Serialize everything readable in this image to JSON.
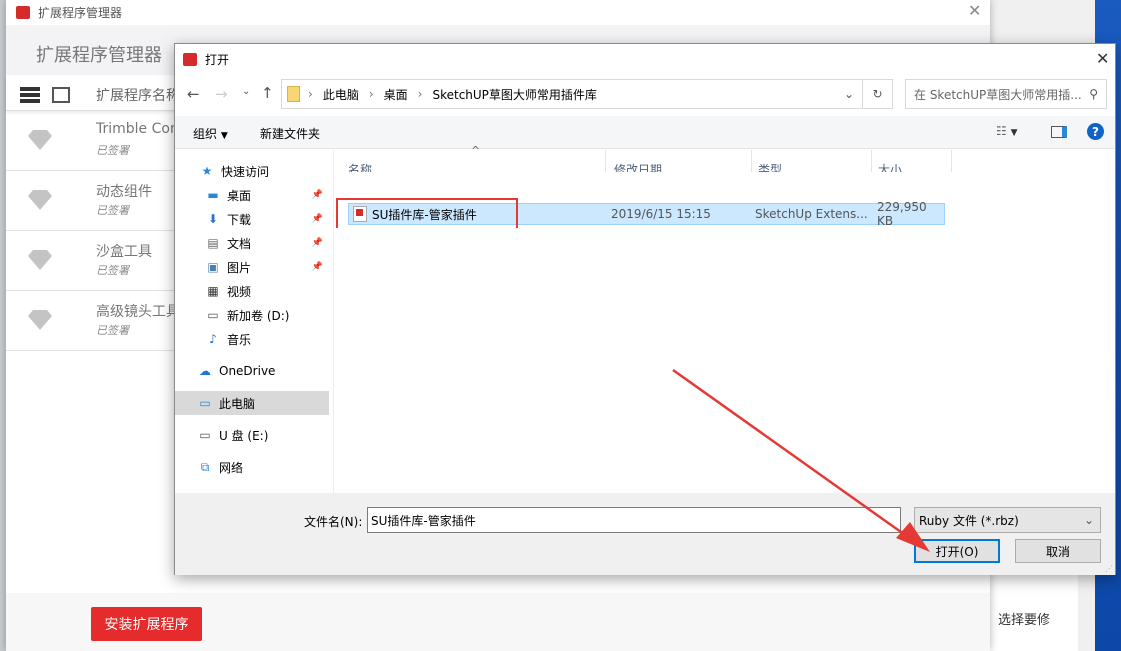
{
  "background": {
    "side_text": "选择要修"
  },
  "manager": {
    "window_title": "扩展程序管理器",
    "heading": "扩展程序管理器",
    "column_label": "扩展程序名称",
    "extensions": [
      {
        "name": "Trimble Con",
        "status": "已签署"
      },
      {
        "name": "动态组件",
        "status": "已签署"
      },
      {
        "name": "沙盒工具",
        "status": "已签署"
      },
      {
        "name": "高级镜头工具",
        "status": "已签署"
      }
    ],
    "install_button": "安装扩展程序"
  },
  "dialog": {
    "title": "打开",
    "breadcrumb": [
      "此电脑",
      "桌面",
      "SketchUP草图大师常用插件库"
    ],
    "search_placeholder": "在 SketchUP草图大师常用插...",
    "toolbar": {
      "organize": "组织",
      "new_folder": "新建文件夹"
    },
    "nav": [
      {
        "label": "快速访问",
        "icon": "star"
      },
      {
        "label": "桌面",
        "icon": "desktop",
        "pinned": true
      },
      {
        "label": "下载",
        "icon": "download",
        "pinned": true
      },
      {
        "label": "文档",
        "icon": "document",
        "pinned": true
      },
      {
        "label": "图片",
        "icon": "picture",
        "pinned": true
      },
      {
        "label": "视频",
        "icon": "video"
      },
      {
        "label": "新加卷 (D:)",
        "icon": "drive"
      },
      {
        "label": "音乐",
        "icon": "music"
      },
      {
        "label": "OneDrive",
        "icon": "cloud"
      },
      {
        "label": "此电脑",
        "icon": "computer",
        "selected": true
      },
      {
        "label": "U 盘 (E:)",
        "icon": "usb"
      },
      {
        "label": "网络",
        "icon": "network"
      }
    ],
    "columns": [
      "名称",
      "修改日期",
      "类型",
      "大小"
    ],
    "files": [
      {
        "name": "SU插件库-管家插件",
        "modified": "2019/6/15 15:15",
        "type": "SketchUp Extens...",
        "size": "229,950 KB"
      }
    ],
    "filename_label": "文件名(N):",
    "filename_value": "SU插件库-管家插件",
    "filter": "Ruby 文件 (*.rbz)",
    "open_button": "打开(O)",
    "cancel_button": "取消"
  },
  "colors": {
    "accent": "#0078d7",
    "install_red": "#e52b2b",
    "annotation_red": "#e53935",
    "selection": "#cce8ff"
  }
}
